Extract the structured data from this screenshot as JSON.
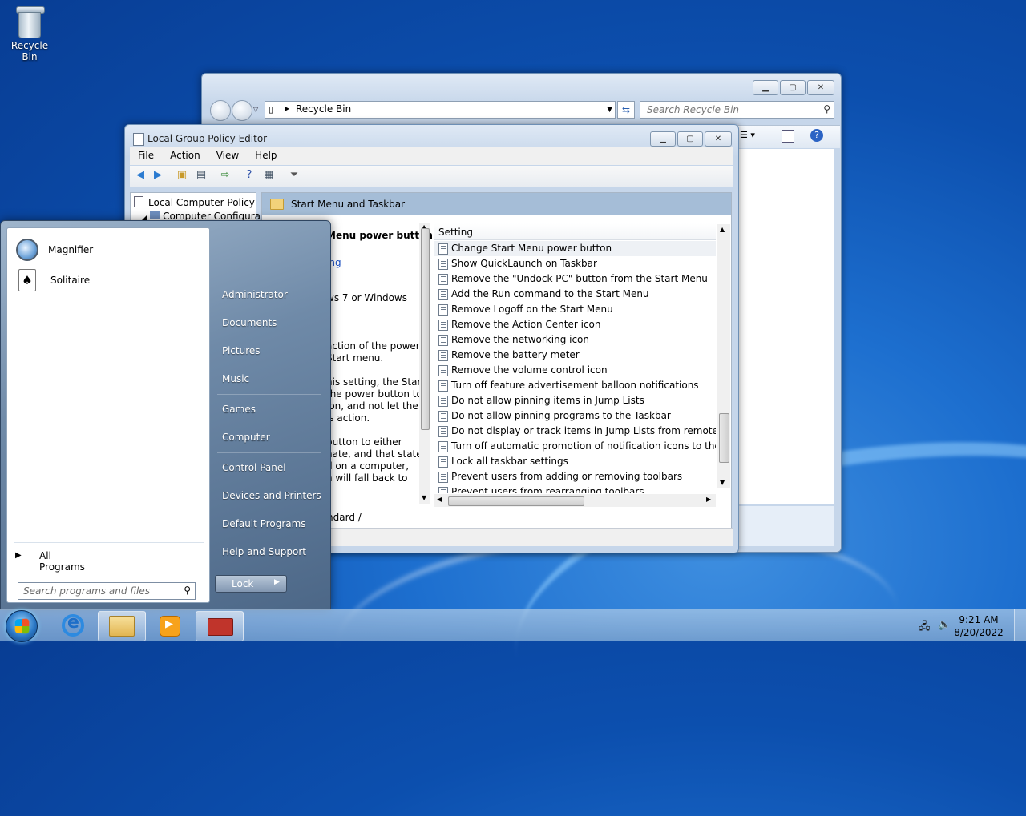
{
  "desktop": {
    "recycle_bin_label": "Recycle Bin"
  },
  "explorer": {
    "address": "Recycle Bin",
    "search_placeholder": "Search Recycle Bin"
  },
  "gpe": {
    "title": "Local Group Policy Editor",
    "menu": [
      "File",
      "Action",
      "View",
      "Help"
    ],
    "tree": [
      "Local Computer Policy",
      "Computer Configura"
    ],
    "header": "Start Menu and Taskbar",
    "extended_lines": [
      "Menu power button",
      "ing",
      "ws 7 or Windows",
      "action of the power",
      "Start menu.",
      "his setting, the Start",
      "the power button to",
      "ion, and not let the",
      "is action.",
      "button to either",
      "nate, and that state",
      "d on a computer,",
      "n will fall back to"
    ],
    "column_header": "Setting",
    "settings": [
      "Change Start Menu power button",
      "Show QuickLaunch on Taskbar",
      "Remove the \"Undock PC\" button from the Start Menu",
      "Add the Run command to the Start Menu",
      "Remove Logoff on the Start Menu",
      "Remove the Action Center icon",
      "Remove the networking icon",
      "Remove the battery meter",
      "Remove the volume control icon",
      "Turn off feature advertisement balloon notifications",
      "Do not allow pinning items in Jump Lists",
      "Do not allow pinning programs to the Taskbar",
      "Do not display or track items in Jump Lists from remote loca...",
      "Turn off automatic promotion of notification icons to the ta...",
      "Lock all taskbar settings",
      "Prevent users from adding or removing toolbars",
      "Prevent users from rearranging toolbars"
    ],
    "tab_standard": "tandard"
  },
  "start_menu": {
    "programs": [
      "Magnifier",
      "Solitaire"
    ],
    "all_programs": "All Programs",
    "search_placeholder": "Search programs and files",
    "right_items": [
      "Administrator",
      "Documents",
      "Pictures",
      "Music",
      "Games",
      "Computer",
      "Control Panel",
      "Devices and Printers",
      "Default Programs",
      "Help and Support"
    ],
    "lock_label": "Lock"
  },
  "taskbar": {
    "time": "9:21 AM",
    "date": "8/20/2022"
  }
}
